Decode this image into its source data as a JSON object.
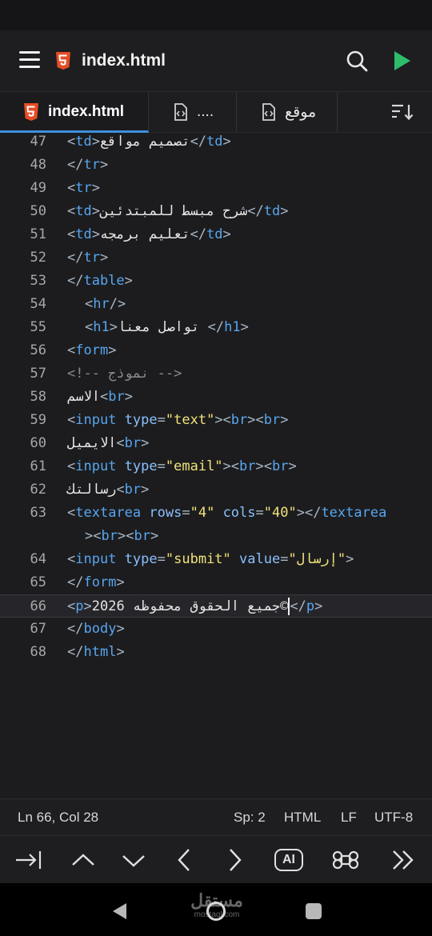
{
  "app_bar": {
    "title": "index.html"
  },
  "tabs": [
    {
      "label": "index.html",
      "active": true
    },
    {
      "label": "....",
      "active": false
    },
    {
      "label": "موقع",
      "active": false
    }
  ],
  "editor": {
    "lines": [
      {
        "n": "47",
        "html": "<span class='p'>&lt;</span><span class='t'>td</span><span class='p'>&gt;</span>تصميم مواقع<span class='p'>&lt;/</span><span class='t'>td</span><span class='p'>&gt;</span>"
      },
      {
        "n": "48",
        "html": "<span class='p'>&lt;/</span><span class='t'>tr</span><span class='p'>&gt;</span>"
      },
      {
        "n": "49",
        "html": "<span class='p'>&lt;</span><span class='t'>tr</span><span class='p'>&gt;</span>"
      },
      {
        "n": "50",
        "html": "<span class='p'>&lt;</span><span class='t'>td</span><span class='p'>&gt;</span>شرح مبسط للمبتدئين<span class='p'>&lt;/</span><span class='t'>td</span><span class='p'>&gt;</span>"
      },
      {
        "n": "51",
        "html": "<span class='p'>&lt;</span><span class='t'>td</span><span class='p'>&gt;</span>تعليم برمجه<span class='p'>&lt;/</span><span class='t'>td</span><span class='p'>&gt;</span>"
      },
      {
        "n": "52",
        "html": "<span class='p'>&lt;/</span><span class='t'>tr</span><span class='p'>&gt;</span>"
      },
      {
        "n": "53",
        "html": "<span class='p'>&lt;/</span><span class='t'>table</span><span class='p'>&gt;</span>"
      },
      {
        "n": "54",
        "html": "<span class='indent'></span><span class='p'>&lt;</span><span class='t'>hr</span><span class='p'>/&gt;</span>"
      },
      {
        "n": "55",
        "html": "<span class='indent'></span><span class='p'>&lt;</span><span class='t'>h1</span><span class='p'>&gt;</span>تواصل معنا <span class='p'>&lt;/</span><span class='t'>h1</span><span class='p'>&gt;</span>"
      },
      {
        "n": "56",
        "html": "<span class='p'>&lt;</span><span class='t'>form</span><span class='p'>&gt;</span>"
      },
      {
        "n": "57",
        "html": "<span class='cm'>&lt;!-- نموذج --&gt;</span>"
      },
      {
        "n": "58",
        "html": "الاسم<span class='p'>&lt;</span><span class='t'>br</span><span class='p'>&gt;</span>"
      },
      {
        "n": "59",
        "html": "<span class='p'>&lt;</span><span class='t'>input</span> <span class='a'>type</span><span class='p'>=</span><span class='s'>\"text\"</span><span class='p'>&gt;&lt;</span><span class='t'>br</span><span class='p'>&gt;&lt;</span><span class='t'>br</span><span class='p'>&gt;</span>"
      },
      {
        "n": "60",
        "html": "الايميل<span class='p'>&lt;</span><span class='t'>br</span><span class='p'>&gt;</span>"
      },
      {
        "n": "61",
        "html": "<span class='p'>&lt;</span><span class='t'>input</span> <span class='a'>type</span><span class='p'>=</span><span class='s'>\"email\"</span><span class='p'>&gt;&lt;</span><span class='t'>br</span><span class='p'>&gt;&lt;</span><span class='t'>br</span><span class='p'>&gt;</span>"
      },
      {
        "n": "62",
        "html": "رسالتك<span class='p'>&lt;</span><span class='t'>br</span><span class='p'>&gt;</span>"
      },
      {
        "n": "63",
        "html": "<span class='p'>&lt;</span><span class='t'>textarea</span> <span class='a'>rows</span><span class='p'>=</span><span class='s'>\"4\"</span> <span class='a'>cols</span><span class='p'>=</span><span class='s'>\"40\"</span><span class='p'>&gt;&lt;/</span><span class='t'>textarea</span>"
      },
      {
        "n": "",
        "cont": true,
        "html": "<span class='p'>&gt;&lt;</span><span class='t'>br</span><span class='p'>&gt;&lt;</span><span class='t'>br</span><span class='p'>&gt;</span>"
      },
      {
        "n": "64",
        "html": "<span class='p'>&lt;</span><span class='t'>input</span> <span class='a'>type</span><span class='p'>=</span><span class='s'>\"submit\"</span> <span class='a'>value</span><span class='p'>=</span><span class='s'>\"إرسال\"</span><span class='p'>&gt;</span>"
      },
      {
        "n": "65",
        "html": "<span class='p'>&lt;/</span><span class='t'>form</span><span class='p'>&gt;</span>"
      },
      {
        "n": "66",
        "current": true,
        "html": "<span class='p'>&lt;</span><span class='t'>p</span><span class='p'>&gt;</span>2026 جميع الحقوق محفوظه©<span class='cursor'></span><span class='p'>&lt;/</span><span class='t'>p</span><span class='p'>&gt;</span>"
      },
      {
        "n": "67",
        "html": "<span class='p'>&lt;/</span><span class='t'>body</span><span class='p'>&gt;</span>"
      },
      {
        "n": "68",
        "html": "<span class='p'>&lt;/</span><span class='t'>html</span><span class='p'>&gt;</span>"
      }
    ]
  },
  "status": {
    "position": "Ln 66, Col 28",
    "spaces": "Sp: 2",
    "language": "HTML",
    "line_ending": "LF",
    "encoding": "UTF-8"
  },
  "key_row": {
    "ai_label": "AI"
  },
  "watermark": {
    "logo": "مستقل",
    "site": "mostaql.com"
  },
  "colors": {
    "accent": "#3d8fe0",
    "html5": "#e44d26",
    "run": "#2ebd6b",
    "tag": "#57a6f0",
    "string": "#f1e27a"
  }
}
